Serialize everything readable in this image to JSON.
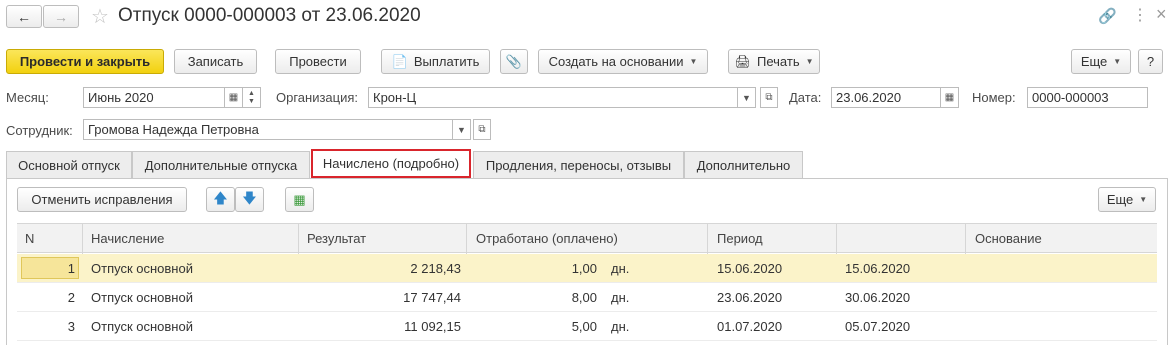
{
  "window": {
    "title": "Отпуск 0000-000003 от 23.06.2020"
  },
  "toolbar": {
    "post_close": "Провести и закрыть",
    "save": "Записать",
    "post": "Провести",
    "pay": "Выплатить",
    "create_based": "Создать на основании",
    "print": "Печать",
    "more": "Еще",
    "help": "?"
  },
  "form": {
    "month_label": "Месяц:",
    "month_value": "Июнь 2020",
    "org_label": "Организация:",
    "org_value": "Крон-Ц",
    "date_label": "Дата:",
    "date_value": "23.06.2020",
    "number_label": "Номер:",
    "number_value": "0000-000003",
    "employee_label": "Сотрудник:",
    "employee_value": "Громова Надежда Петровна"
  },
  "tabs": [
    {
      "label": "Основной отпуск"
    },
    {
      "label": "Дополнительные отпуска"
    },
    {
      "label": "Начислено (подробно)"
    },
    {
      "label": "Продления, переносы, отзывы"
    },
    {
      "label": "Дополнительно"
    }
  ],
  "subtoolbar": {
    "cancel_corrections": "Отменить исправления",
    "more": "Еще"
  },
  "table": {
    "columns": [
      "N",
      "Начисление",
      "Результат",
      "Отработано (оплачено)",
      "Период",
      "",
      "Основание"
    ],
    "rows": [
      {
        "n": "1",
        "accrual": "Отпуск основной",
        "result": "2 218,43",
        "worked": "1,00",
        "unit": "дн.",
        "from": "15.06.2020",
        "to": "15.06.2020",
        "basis": ""
      },
      {
        "n": "2",
        "accrual": "Отпуск основной",
        "result": "17 747,44",
        "worked": "8,00",
        "unit": "дн.",
        "from": "23.06.2020",
        "to": "30.06.2020",
        "basis": ""
      },
      {
        "n": "3",
        "accrual": "Отпуск основной",
        "result": "11 092,15",
        "worked": "5,00",
        "unit": "дн.",
        "from": "01.07.2020",
        "to": "05.07.2020",
        "basis": ""
      }
    ]
  },
  "colors": {
    "primary_button": "#f2d10f",
    "active_tab_outline": "#d9252c",
    "selected_row": "#fbf3c9"
  }
}
